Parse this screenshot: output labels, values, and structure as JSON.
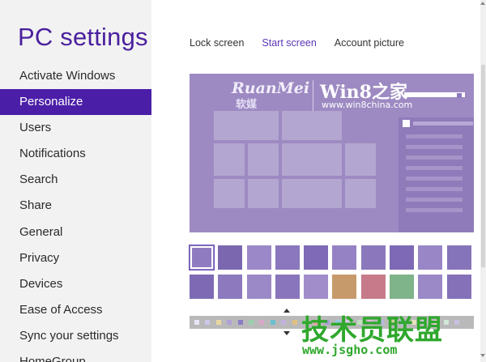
{
  "app": {
    "title": "PC settings"
  },
  "sidebar": {
    "items": [
      {
        "label": "Activate Windows"
      },
      {
        "label": "Personalize",
        "active": true
      },
      {
        "label": "Users"
      },
      {
        "label": "Notifications"
      },
      {
        "label": "Search"
      },
      {
        "label": "Share"
      },
      {
        "label": "General"
      },
      {
        "label": "Privacy"
      },
      {
        "label": "Devices"
      },
      {
        "label": "Ease of Access"
      },
      {
        "label": "Sync your settings"
      },
      {
        "label": "HomeGroup"
      }
    ]
  },
  "tabs": [
    {
      "label": "Lock screen"
    },
    {
      "label": "Start screen",
      "active": true
    },
    {
      "label": "Account picture"
    }
  ],
  "preview": {
    "watermark_left": "RuanMei",
    "watermark_left_sub": "软媒",
    "watermark_right": "Win8之家",
    "watermark_url": "www.win8china.com"
  },
  "background_patterns": {
    "row1": [
      "#8f7cc0",
      "#7a67b0",
      "#9a88c8",
      "#8a77bd",
      "#7e6ab6",
      "#9582c4",
      "#8b78bc",
      "#7d69b5",
      "#9886c6",
      "#8674ba"
    ],
    "row2": [
      "#7e6ab4",
      "#8c79be",
      "#9a88c7",
      "#8975bb",
      "#a08dca",
      "#c79a6c",
      "#c77b8a",
      "#7fb38a",
      "#9a88c7",
      "#8471b8"
    ],
    "selected_index": 0
  },
  "color_scheme": {
    "colors": [
      "#e8e4f4",
      "#cfc5e8",
      "#e8d8a0",
      "#b0a0d8",
      "#8c7bc4",
      "#9ad0b0",
      "#d8a8c8",
      "#6ac0d0",
      "#c4b0e0",
      "#e0c080",
      "#a0d0a0",
      "#f0a0a0",
      "#a8a0d8",
      "#98c8e0",
      "#d8c8e8",
      "#c0e0c0",
      "#e0b8d8",
      "#b8b8e0",
      "#d0d0a0",
      "#a0c0e0",
      "#e8e0c0",
      "#c8d0e8",
      "#e8c8c8",
      "#d0e8d8",
      "#c8c0e0"
    ]
  },
  "site_watermark": {
    "text": "技术员联盟",
    "url": "www.jsgho.com"
  }
}
